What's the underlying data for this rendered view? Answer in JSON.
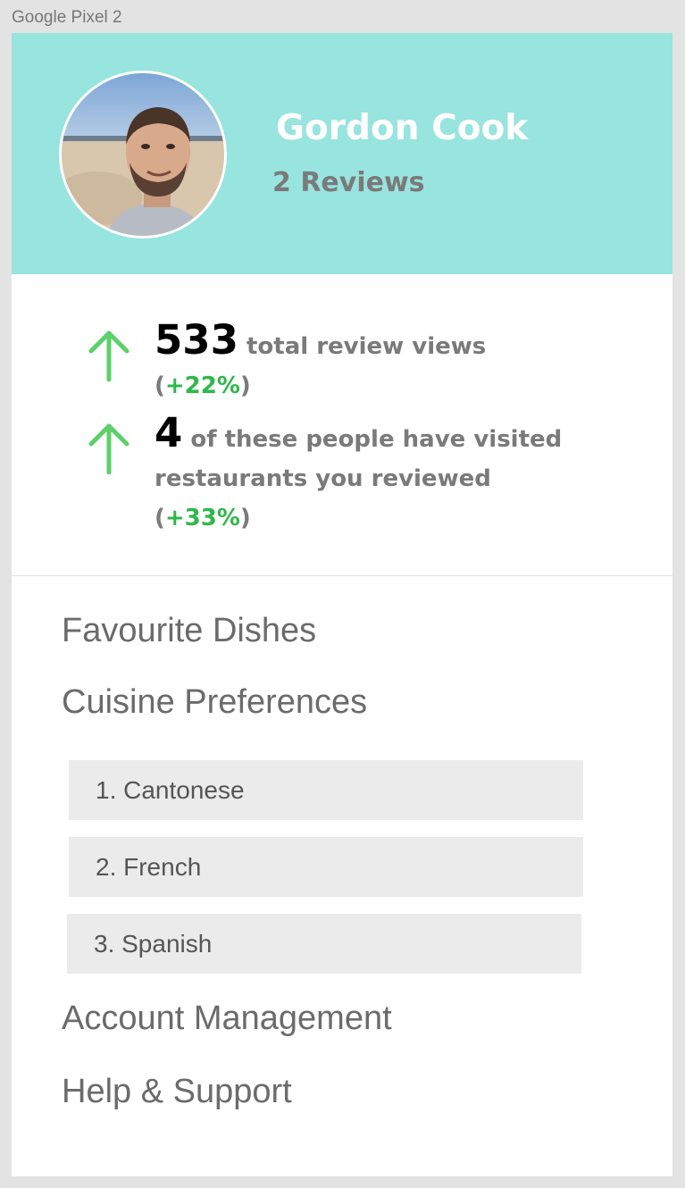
{
  "device_label": "Google Pixel 2",
  "colors": {
    "header_bg": "#98e4df",
    "accent_green": "#2fb84a",
    "muted_text": "#7a7a7a",
    "pref_bg": "#ebebeb"
  },
  "profile": {
    "name": "Gordon Cook",
    "reviews": "2 Reviews"
  },
  "stats": [
    {
      "icon": "arrow-up-icon",
      "number": "533",
      "text": " total review views (",
      "pct": "+22%",
      "close": ")"
    },
    {
      "icon": "arrow-up-icon",
      "number": "4",
      "text": " of these people have visited restaurants you reviewed (",
      "pct": "+33%",
      "close": ")"
    }
  ],
  "menu": {
    "favourite_dishes": "Favourite Dishes",
    "cuisine_preferences": "Cuisine Preferences",
    "account_management": "Account Management",
    "help_support": "Help & Support"
  },
  "cuisine_list": [
    "1. Cantonese",
    "2. French",
    "3. Spanish"
  ]
}
